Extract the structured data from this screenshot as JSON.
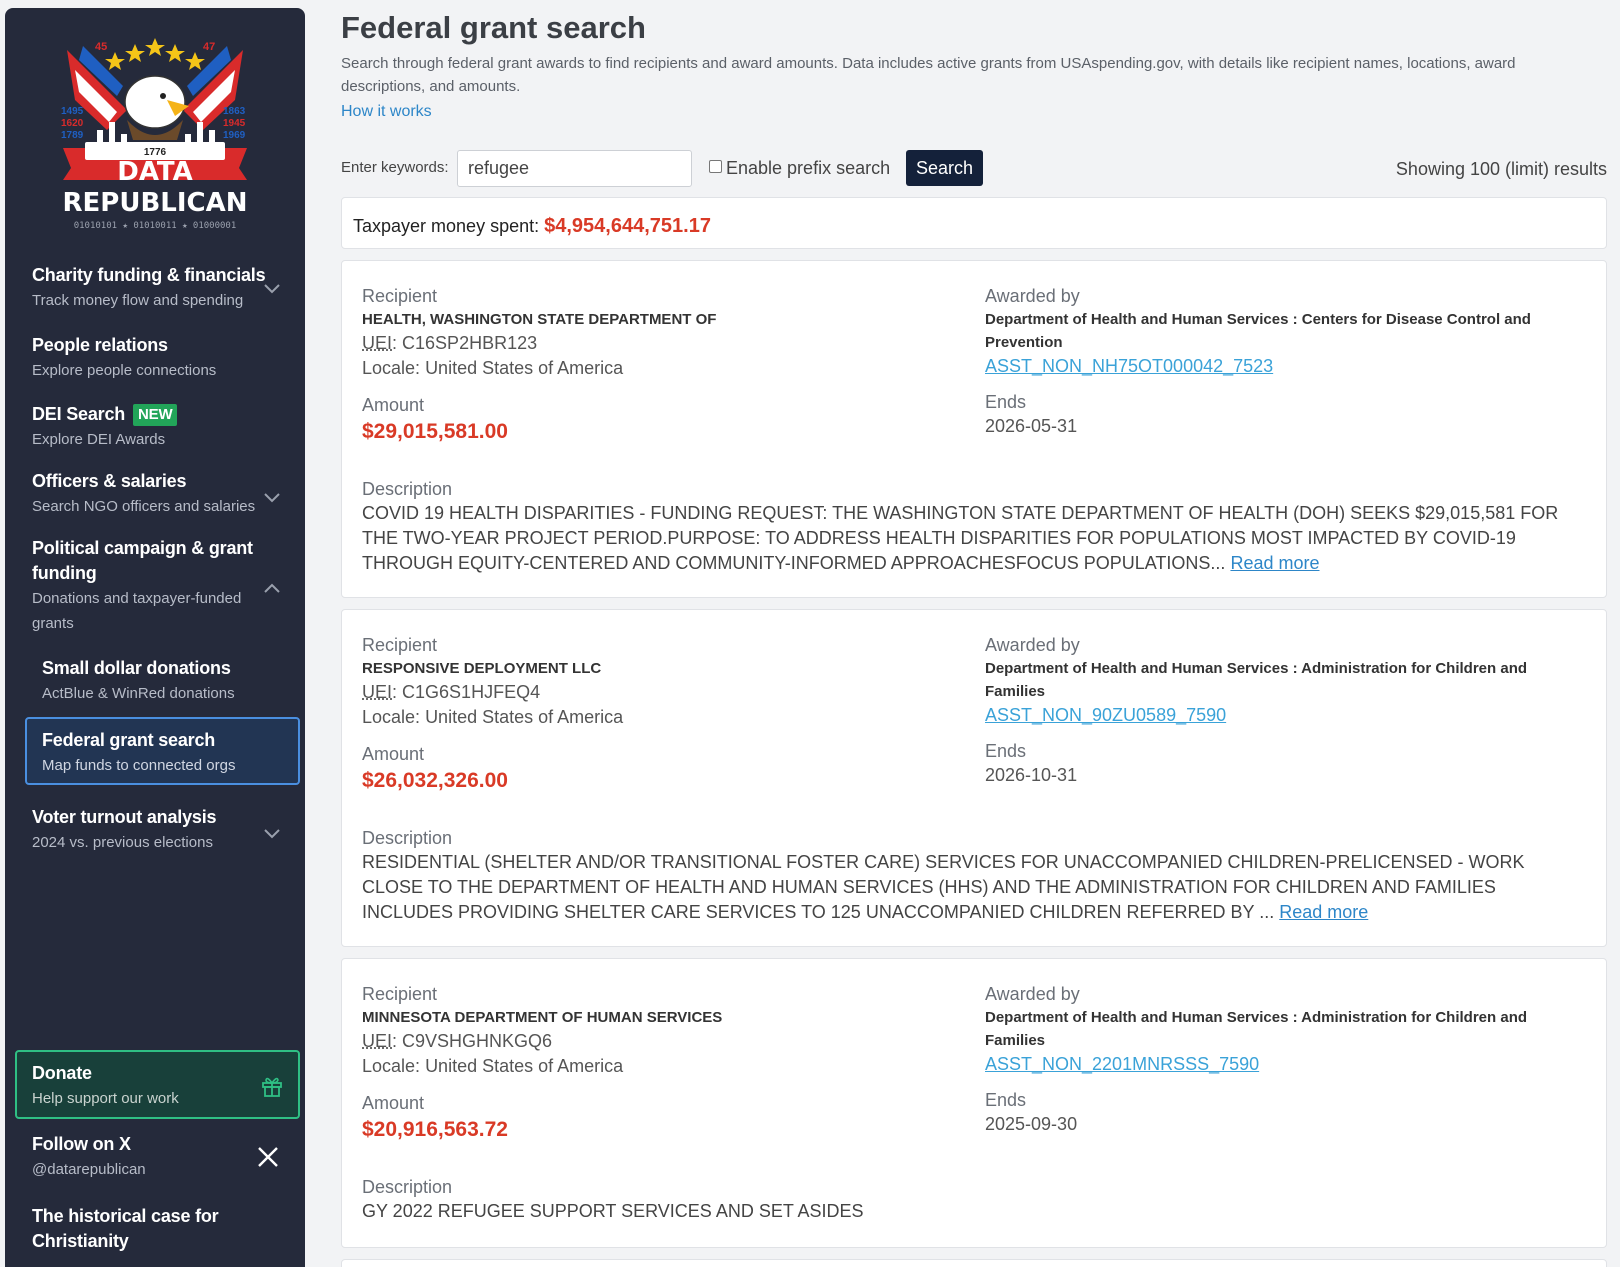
{
  "sidebar": {
    "logo": {
      "line1": "DATA",
      "line2": "REPUBLICAN",
      "year": "1776",
      "binary": "01010101 ★ 01010011 ★ 01000001",
      "left_years": [
        "1495",
        "1620",
        "1789"
      ],
      "right_years": [
        "1863",
        "1945",
        "1969"
      ],
      "top_numbers": [
        "45",
        "47"
      ]
    },
    "items": [
      {
        "title": "Charity funding & financials",
        "sub": "Track money flow and spending"
      },
      {
        "title": "People relations",
        "sub": "Explore people connections"
      },
      {
        "title": "DEI Search",
        "badge": "NEW",
        "sub": "Explore DEI Awards"
      },
      {
        "title": "Officers & salaries",
        "sub": "Search NGO officers and salaries"
      },
      {
        "title_line1": "Political campaign & grant",
        "title_line2": "funding",
        "sub_line1": "Donations and taxpayer-funded",
        "sub_line2": "grants"
      },
      {
        "title": "Small dollar donations",
        "sub": "ActBlue & WinRed donations"
      },
      {
        "title": "Federal grant search",
        "sub": "Map funds to connected orgs"
      },
      {
        "title": "Voter turnout analysis",
        "sub": "2024 vs. previous elections"
      }
    ],
    "donate": {
      "title": "Donate",
      "sub": "Help support our work"
    },
    "follow": {
      "title": "Follow on X",
      "sub": "@datarepublican"
    },
    "historical": {
      "line1": "The historical case for",
      "line2": "Christianity"
    }
  },
  "page": {
    "title": "Federal grant search",
    "description": "Search through federal grant awards to find recipients and award amounts. Data includes active grants from USAspending.gov, with details like recipient names, locations, award descriptions, and amounts.",
    "how_link": "How it works"
  },
  "search": {
    "label": "Enter keywords:",
    "value": "refugee",
    "prefix_label": "Enable prefix search",
    "prefix_checked": false,
    "button": "Search",
    "results_text": "Showing 100 (limit) results"
  },
  "summary": {
    "label": "Taxpayer money spent:",
    "value": "$4,954,644,751.17"
  },
  "labels": {
    "recipient": "Recipient",
    "awarded_by": "Awarded by",
    "amount": "Amount",
    "ends": "Ends",
    "description": "Description",
    "uei": "UEI",
    "locale_prefix": "Locale:",
    "read_more": "Read more"
  },
  "results": [
    {
      "recipient": "HEALTH, WASHINGTON STATE DEPARTMENT OF",
      "uei": "C16SP2HBR123",
      "locale": "United States of America",
      "amount": "$29,015,581.00",
      "awarded_by_line1": "Department of Health and Human Services : Centers for Disease Control and",
      "awarded_by_line2": "Prevention",
      "award_id": "ASST_NON_NH75OT000042_7523",
      "ends": "2026-05-31",
      "description": "COVID 19 HEALTH DISPARITIES - FUNDING REQUEST: THE WASHINGTON STATE DEPARTMENT OF HEALTH (DOH) SEEKS $29,015,581 FOR THE TWO-YEAR PROJECT PERIOD.PURPOSE: TO ADDRESS HEALTH DISPARITIES FOR POPULATIONS MOST IMPACTED BY COVID-19 THROUGH EQUITY-CENTERED AND COMMUNITY-INFORMED APPROACHESFOCUS POPULATIONS...",
      "has_more": true
    },
    {
      "recipient": "RESPONSIVE DEPLOYMENT LLC",
      "uei": "C1G6S1HJFEQ4",
      "locale": "United States of America",
      "amount": "$26,032,326.00",
      "awarded_by_line1": "Department of Health and Human Services : Administration for Children and",
      "awarded_by_line2": "Families",
      "award_id": "ASST_NON_90ZU0589_7590",
      "ends": "2026-10-31",
      "description": "RESIDENTIAL (SHELTER AND/OR TRANSITIONAL FOSTER CARE) SERVICES FOR UNACCOMPANIED CHILDREN-PRELICENSED - WORK CLOSE TO THE DEPARTMENT OF HEALTH AND HUMAN SERVICES (HHS) AND THE ADMINISTRATION FOR CHILDREN AND FAMILIES INCLUDES PROVIDING SHELTER CARE SERVICES TO 125 UNACCOMPANIED CHILDREN REFERRED BY ...",
      "has_more": true
    },
    {
      "recipient": "MINNESOTA DEPARTMENT OF HUMAN SERVICES",
      "uei": "C9VSHGHNKGQ6",
      "locale": "United States of America",
      "amount": "$20,916,563.72",
      "awarded_by_line1": "Department of Health and Human Services : Administration for Children and",
      "awarded_by_line2": "Families",
      "award_id": "ASST_NON_2201MNRSSS_7590",
      "ends": "2025-09-30",
      "description": "GY 2022 REFUGEE SUPPORT SERVICES AND SET ASIDES",
      "has_more": false
    }
  ],
  "colors": {
    "sidebar_bg": "#252a3b",
    "accent_red": "#d93a26",
    "link_blue": "#3aa2d8",
    "new_badge": "#22a559",
    "active_border": "#4a8fe0",
    "donate_border": "#2fbf84"
  },
  "icons": [
    "chevron-down-icon",
    "chevron-up-icon",
    "gift-icon",
    "x-logo-icon",
    "eagle-logo"
  ]
}
